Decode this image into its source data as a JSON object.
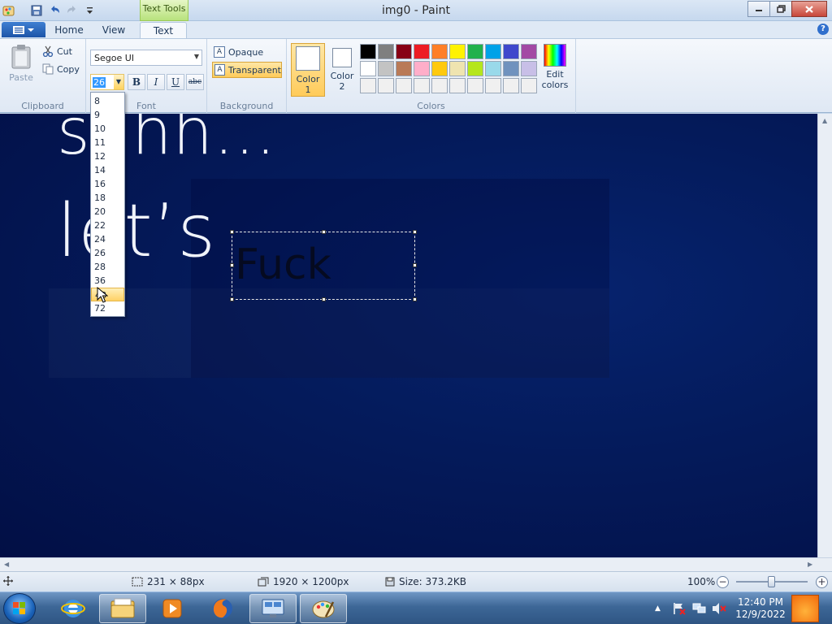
{
  "window": {
    "title": "img0 - Paint",
    "context_tab": "Text Tools"
  },
  "tabs": [
    {
      "label": "Home"
    },
    {
      "label": "View"
    },
    {
      "label": "Text"
    }
  ],
  "clipboard": {
    "paste": "Paste",
    "cut": "Cut",
    "copy": "Copy",
    "group": "Clipboard"
  },
  "font": {
    "family": "Segoe UI",
    "size": "26",
    "group": "Font",
    "bold": "B",
    "italic": "I",
    "underline": "U",
    "strike": "abc"
  },
  "background": {
    "opaque": "Opaque",
    "transparent": "Transparent",
    "group": "Background"
  },
  "colors": {
    "color1": "Color",
    "color1_num": "1",
    "color2": "Color",
    "color2_num": "2",
    "edit": "Edit",
    "edit2": "colors",
    "group": "Colors",
    "palette": [
      "#000000",
      "#7f7f7f",
      "#880015",
      "#ed1c24",
      "#ff7f27",
      "#fff200",
      "#22b14c",
      "#00a2e8",
      "#3f48cc",
      "#a349a4",
      "#ffffff",
      "#c3c3c3",
      "#b97a57",
      "#ffaec9",
      "#ffc90e",
      "#efe4b0",
      "#b5e61d",
      "#99d9ea",
      "#7092be",
      "#c8bfe7",
      "#f0f0f0",
      "#f0f0f0",
      "#f0f0f0",
      "#f0f0f0",
      "#f0f0f0",
      "#f0f0f0",
      "#f0f0f0",
      "#f0f0f0",
      "#f0f0f0",
      "#f0f0f0"
    ]
  },
  "font_sizes": [
    "8",
    "9",
    "10",
    "11",
    "12",
    "14",
    "16",
    "18",
    "20",
    "22",
    "24",
    "26",
    "28",
    "36",
    "48",
    "72"
  ],
  "font_sizes_highlighted": "48",
  "canvas": {
    "line1": "shhh...",
    "line2": "let’s",
    "typed_text": "Fuck"
  },
  "status": {
    "selection": "231 × 88px",
    "image_size": "1920 × 1200px",
    "file_size": "Size: 373.2KB",
    "zoom": "100%"
  },
  "taskbar": {
    "time": "12:40 PM",
    "date": "12/9/2022"
  }
}
